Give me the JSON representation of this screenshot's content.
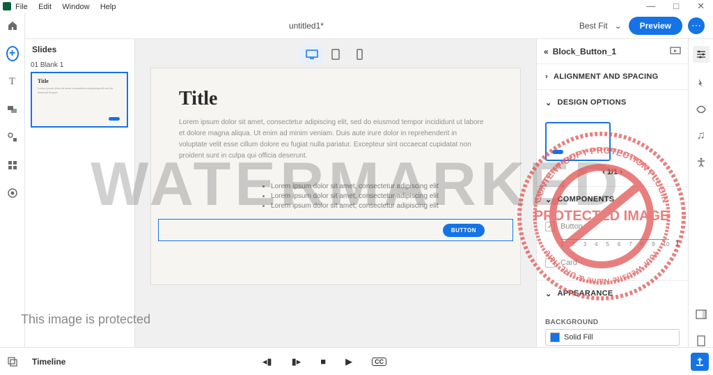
{
  "menu": {
    "file": "File",
    "edit": "Edit",
    "window": "Window",
    "help": "Help"
  },
  "document": {
    "title": "untitled1*"
  },
  "zoom": {
    "label": "Best Fit"
  },
  "buttons": {
    "preview": "Preview"
  },
  "slides": {
    "heading": "Slides",
    "item_label": "01  Blank 1",
    "thumb_title": "Title"
  },
  "canvas": {
    "title": "Title",
    "body": "Lorem ipsum dolor sit amet, consectetur adipiscing elit, sed do eiusmod tempor incididunt ut labore et dolore magna aliqua. Ut enim ad minim veniam. Duis aute irure dolor in reprehenderit in voluptate velit esse cillum dolore eu fugiat nulla pariatur. Excepteur sint occaecat cupidatat non proident sunt in culpa qui officia deserunt.",
    "bullets": [
      "Lorem ipsum dolor sit amet, consectetur adipiscing elit",
      "Lorem ipsum dolor sit amet, consectetur adipiscing elit",
      "Lorem ipsum dolor sit amet, consectetur adipiscing elit"
    ],
    "button_label": "BUTTON"
  },
  "props": {
    "header": "Block_Button_1",
    "sections": {
      "alignment": "ALIGNMENT AND SPACING",
      "design": "DESIGN OPTIONS",
      "components": "COMPONENTS",
      "appearance": "APPEARANCE"
    },
    "pager": "1/1",
    "comp_button": "Button",
    "comp_card": "Card",
    "slider_value": "1",
    "ticks": [
      "1",
      "2",
      "3",
      "4",
      "5",
      "6",
      "7",
      "8",
      "9",
      "10"
    ],
    "background_label": "BACKGROUND",
    "background_value": "Solid Fill"
  },
  "timeline": {
    "label": "Timeline"
  },
  "overlay": {
    "watermark": "WATERMARKED",
    "protected": "This image is protected",
    "stamp_top": "CONTENT COPY PROTECTION PLUGIN",
    "stamp_mid": "PROTECTED IMAGE",
    "stamp_bottom": "Your Website Name & URL Here"
  }
}
